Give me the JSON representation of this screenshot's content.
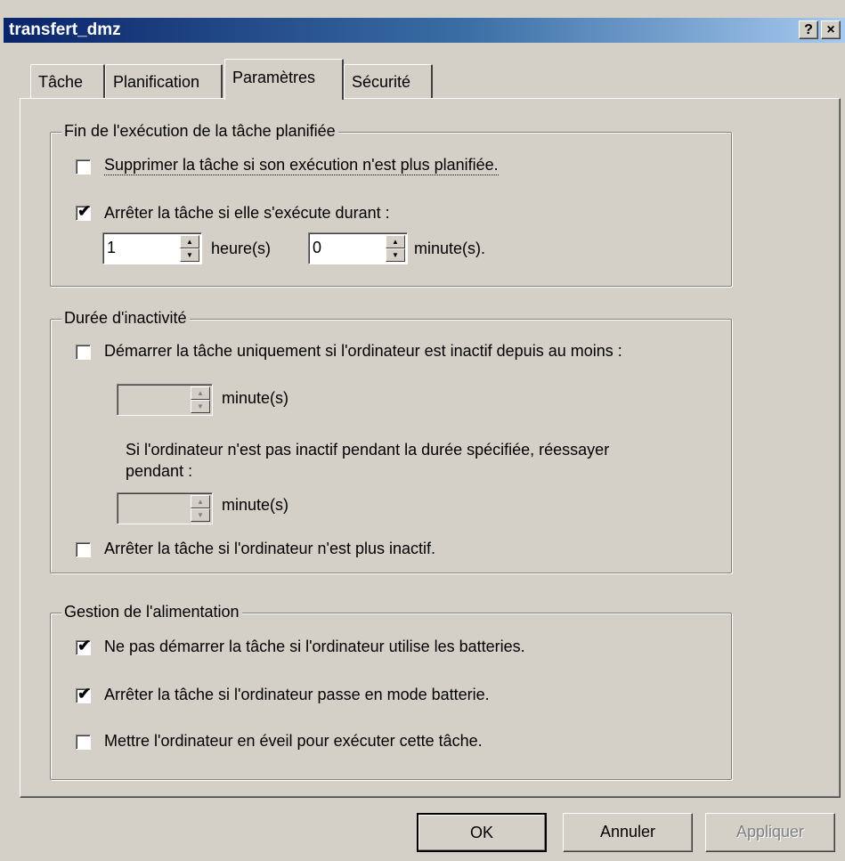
{
  "window": {
    "title": "transfert_dmz",
    "help_button": "?",
    "close_button": "×"
  },
  "tabs": [
    {
      "label": "Tâche"
    },
    {
      "label": "Planification"
    },
    {
      "label": "Paramètres"
    },
    {
      "label": "Sécurité"
    }
  ],
  "active_tab": "Paramètres",
  "end_group": {
    "legend": "Fin de l'exécution de la tâche planifiée",
    "delete_checkbox": {
      "label": "Supprimer la tâche si son exécution n'est plus planifiée.",
      "checked": false
    },
    "stop_checkbox": {
      "label": "Arrêter la tâche si elle s'exécute durant :",
      "checked": true
    },
    "hours_value": "1",
    "hours_label": "heure(s)",
    "minutes_value": "0",
    "minutes_label": "minute(s)."
  },
  "idle_group": {
    "legend": "Durée d'inactivité",
    "start_idle_checkbox": {
      "label": "Démarrer la tâche uniquement si l'ordinateur est inactif depuis au moins :",
      "checked": false
    },
    "idle_minutes_label": "minute(s)",
    "retry_text_1": "Si l'ordinateur n'est pas inactif pendant la durée spécifiée, réessayer",
    "retry_text_2": "pendant :",
    "retry_minutes_label": "minute(s)",
    "stop_idle_checkbox": {
      "label": "Arrêter la tâche si l'ordinateur n'est plus inactif.",
      "checked": false
    }
  },
  "power_group": {
    "legend": "Gestion de l'alimentation",
    "no_battery_start": {
      "label": "Ne pas démarrer la tâche si l'ordinateur utilise les batteries.",
      "checked": true
    },
    "stop_on_battery": {
      "label": "Arrêter la tâche si l'ordinateur passe en mode batterie.",
      "checked": true
    },
    "wake_computer": {
      "label": "Mettre l'ordinateur en éveil pour exécuter cette tâche.",
      "checked": false
    }
  },
  "buttons": {
    "ok": "OK",
    "cancel": "Annuler",
    "apply": "Appliquer"
  },
  "check_mark": "✔",
  "arrow_up": "▲",
  "arrow_down": "▼"
}
